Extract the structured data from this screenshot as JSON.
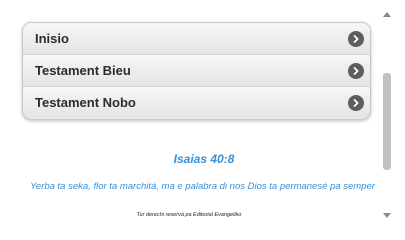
{
  "menu": {
    "items": [
      {
        "label": "Inisio",
        "icon": "chevron-right-circle-icon"
      },
      {
        "label": "Testament Bieu",
        "icon": "chevron-right-circle-icon"
      },
      {
        "label": "Testament Nobo",
        "icon": "chevron-right-circle-icon"
      }
    ]
  },
  "verse": {
    "reference": "Isaias 40:8",
    "text": "Yerba ta seka, flor ta marchitá, ma e palabra di nos Dios ta permanesé pa semper"
  },
  "footer": {
    "copyright": "Tur derechi reservá pa Editorial Evangeliko"
  },
  "scrollbar": {
    "position_fraction": 0.3
  },
  "colors": {
    "accent": "#3a8fd6",
    "menu_text": "#2c2c2c",
    "arrow_bg": "#5d5d5d"
  }
}
